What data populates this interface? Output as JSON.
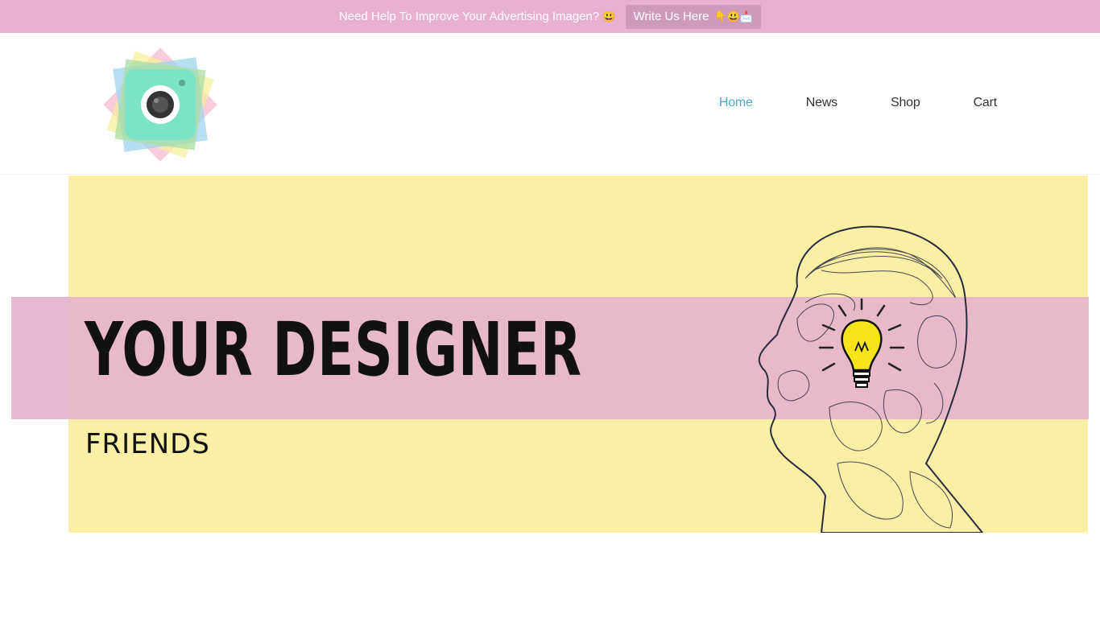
{
  "topbar": {
    "message": "Need Help To Improve Your Advertising Imagen?",
    "message_emoji": "😃",
    "cta_label": "Write Us Here",
    "cta_emoji": "👇😃📩",
    "bg_color": "#e7b1cf"
  },
  "header": {
    "logo_icon": "camera-logo-icon",
    "nav": {
      "items": [
        {
          "label": "Home",
          "active": true
        },
        {
          "label": "News",
          "active": false
        },
        {
          "label": "Shop",
          "active": false
        },
        {
          "label": "Cart",
          "active": false
        }
      ],
      "active_color": "#4aa6d9"
    }
  },
  "hero": {
    "headline": "YOUR DESIGNER",
    "subline": "FRIENDS",
    "bg_color": "#fbeea5",
    "band_color": "#e8b9c8",
    "illustration": "head-lightbulb-icon"
  }
}
